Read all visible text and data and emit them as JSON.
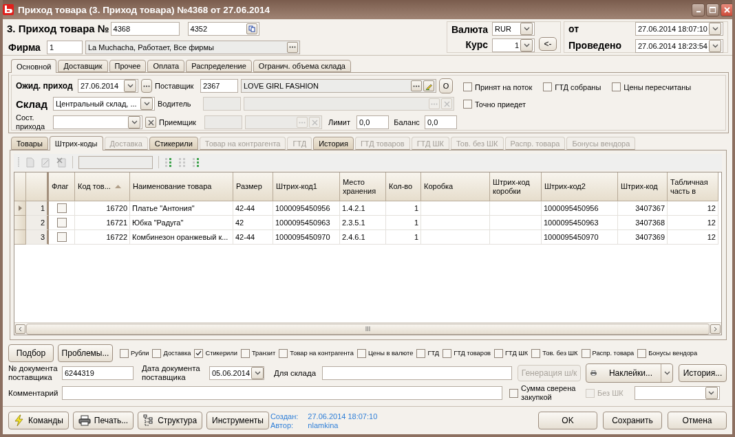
{
  "window": {
    "title": "Приход товара (3. Приход товара) №4368 от 27.06.2014"
  },
  "header": {
    "doc_label": "3. Приход товара №",
    "number": "4368",
    "number2": "4352",
    "firm_label": "Фирма",
    "firm_code": "1",
    "firm_name": "La Muchacha, Работает, Все фирмы",
    "currency_label": "Валюта",
    "currency": "RUR",
    "rate_label": "Курс",
    "rate": "1",
    "rate_button": "<-",
    "date_label": "от",
    "date": "27.06.2014 18:07:10",
    "posted_label": "Проведено",
    "posted": "27.06.2014 18:23:54"
  },
  "top_tabs": [
    {
      "label": "Основной",
      "selected": true
    },
    {
      "label": "Доставщик",
      "selected": false
    },
    {
      "label": "Прочее",
      "selected": false
    },
    {
      "label": "Оплата",
      "selected": false
    },
    {
      "label": "Распределение",
      "selected": false
    },
    {
      "label": "Огранич. объема склада",
      "selected": false
    }
  ],
  "main": {
    "expected_label": "Ожид. приход",
    "expected_date": "27.06.2014",
    "supplier_label": "Поставщик",
    "supplier_code": "2367",
    "supplier_name": "LOVE GIRL FASHION",
    "o_button": "O",
    "warehouse_label": "Склад",
    "warehouse": "Центральный склад, ...",
    "driver_label": "Водитель",
    "state_label": "Сост. прихода",
    "receiver_label": "Приемщик",
    "limit_label": "Лимит",
    "limit": "0,0",
    "balance_label": "Баланс",
    "balance": "0,0"
  },
  "flags": [
    {
      "label": "Принят на поток",
      "checked": false
    },
    {
      "label": "ГТД собраны",
      "checked": false
    },
    {
      "label": "Цены пересчитаны",
      "checked": false
    },
    {
      "label": "Точно приедет",
      "checked": false
    }
  ],
  "detail_tabs": [
    {
      "label": "Товары",
      "selected": false,
      "disabled": false
    },
    {
      "label": "Штрих-коды",
      "selected": true,
      "disabled": false
    },
    {
      "label": "Доставка",
      "selected": false,
      "disabled": true
    },
    {
      "label": "Стикерили",
      "selected": false,
      "disabled": false
    },
    {
      "label": "Товар на контрагента",
      "selected": false,
      "disabled": true
    },
    {
      "label": "ГТД",
      "selected": false,
      "disabled": true
    },
    {
      "label": "История",
      "selected": false,
      "disabled": false
    },
    {
      "label": "ГТД товаров",
      "selected": false,
      "disabled": true
    },
    {
      "label": "ГТД ШК",
      "selected": false,
      "disabled": true
    },
    {
      "label": "Тов. без ШК",
      "selected": false,
      "disabled": true
    },
    {
      "label": "Распр. товара",
      "selected": false,
      "disabled": true
    },
    {
      "label": "Бонусы вендора",
      "selected": false,
      "disabled": true
    }
  ],
  "grid": {
    "flag_column": "Флаг",
    "columns": [
      {
        "label": "Код тов...",
        "sorted": true
      },
      {
        "label": "Наименование товара",
        "sorted": false
      },
      {
        "label": "Размер",
        "sorted": false
      },
      {
        "label": "Штрих-код1",
        "sorted": false
      },
      {
        "label": "Место хранения",
        "sorted": false
      },
      {
        "label": "Кол-во",
        "sorted": false
      },
      {
        "label": "Коробка",
        "sorted": false
      },
      {
        "label": "Штрих-код коробки",
        "sorted": false
      },
      {
        "label": "Штрих-код2",
        "sorted": false
      },
      {
        "label": "Штрих-код",
        "sorted": false
      },
      {
        "label": "Табличная часть в",
        "sorted": false
      }
    ],
    "rows": [
      {
        "selected": true,
        "number": "1",
        "flag": false,
        "cells": [
          "16720",
          "Платье \"Антония\"",
          "42-44",
          "1000095450956",
          "1.4.2.1",
          "1",
          "",
          "",
          "1000095450956",
          "3407367",
          "12"
        ]
      },
      {
        "selected": false,
        "number": "2",
        "flag": false,
        "cells": [
          "16721",
          "Юбка \"Радуга\"",
          "42",
          "1000095450963",
          "2.3.5.1",
          "1",
          "",
          "",
          "1000095450963",
          "3407368",
          "12"
        ]
      },
      {
        "selected": false,
        "number": "3",
        "flag": false,
        "cells": [
          "16722",
          "Комбинезон оранжевый к...",
          "42-44",
          "1000095450970",
          "2.4.6.1",
          "1",
          "",
          "",
          "1000095450970",
          "3407369",
          "12"
        ]
      }
    ]
  },
  "actions": [
    "Подбор",
    "Проблемы..."
  ],
  "options": [
    {
      "label": "Рубли",
      "checked": false
    },
    {
      "label": "Доставка",
      "checked": false
    },
    {
      "label": "Стикерили",
      "checked": true
    },
    {
      "label": "Транзит",
      "checked": false
    },
    {
      "label": "Товар на контрагента",
      "checked": false
    },
    {
      "label": "Цены в валюте",
      "checked": false
    },
    {
      "label": "ГТД",
      "checked": false
    },
    {
      "label": "ГТД товаров",
      "checked": false
    },
    {
      "label": "ГТД ШК",
      "checked": false
    },
    {
      "label": "Тов. без ШК",
      "checked": false
    },
    {
      "label": "Распр. товара",
      "checked": false
    },
    {
      "label": "Бонусы вендора",
      "checked": false
    }
  ],
  "document": {
    "doc_no_label": "№ документа поставщика",
    "doc_no": "6244319",
    "doc_date_label": "Дата документа поставщика",
    "doc_date": "05.06.2014",
    "for_warehouse_label": "Для склада",
    "generate_button": {
      "label": "Генерация ш/к",
      "disabled": true
    },
    "stickers_button": "Наклейки...",
    "history_button": "История...",
    "comment_label": "Комментарий",
    "sum_checked": {
      "label": "Сумма сверена закупкой",
      "checked": false
    },
    "no_barcode": {
      "label": "Без ШК",
      "checked": false,
      "disabled": true
    }
  },
  "footer": {
    "buttons": [
      "Команды",
      "Печать...",
      "Структура",
      "Инструменты"
    ],
    "created_label": "Создан:",
    "created": "27.06.2014 18:07:10",
    "author_label": "Автор:",
    "author": "nlamkina",
    "dialog_buttons": [
      "OK",
      "Сохранить",
      "Отмена"
    ]
  }
}
